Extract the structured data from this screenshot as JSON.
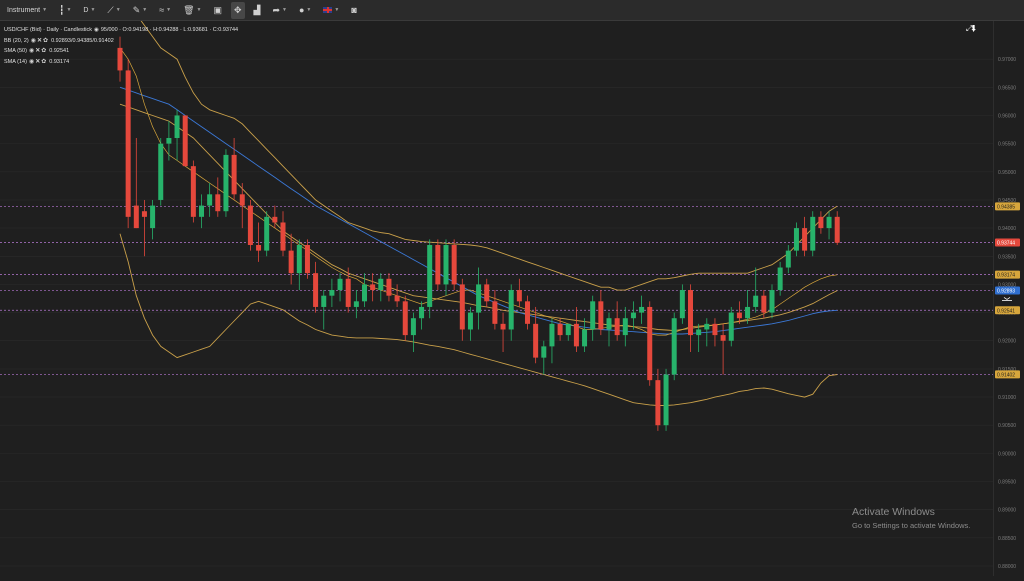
{
  "toolbar": {
    "instrument_label": "Instrument",
    "timeframe_label": "D",
    "flag_label": "UK"
  },
  "legend": {
    "title": "USD/CHF (Bid) · Daily · Candlestick",
    "ohlc": "95/000 · O:0.94198 · H:0.94288 · L:0.93681 · C:0.93744",
    "indicators": [
      {
        "name": "BB (20, 2)",
        "value": "0.92893/0.94385/0.91402"
      },
      {
        "name": "SMA (50)",
        "value": "0.92541"
      },
      {
        "name": "SMA (14)",
        "value": "0.93174"
      }
    ]
  },
  "watermark": {
    "title": "Activate Windows",
    "subtitle": "Go to Settings to activate Windows."
  },
  "colors": {
    "bg": "#1f1f1f",
    "up": "#27b36b",
    "down": "#e5483c",
    "bb": "#c9a04a",
    "sma50": "#3b78d6",
    "sma14": "#d7a63c",
    "level_line": "#b779d4"
  },
  "chart_data": {
    "type": "candlestick",
    "instrument": "USD/CHF (Bid)",
    "timeframe": "Daily",
    "price_axis": {
      "ylim": [
        0.88,
        0.975
      ],
      "ticks": [
        "0.97000",
        "0.96500",
        "0.96000",
        "0.95500",
        "0.95000",
        "0.94500",
        "0.94000",
        "0.93500",
        "0.93000",
        "0.92500",
        "0.92000",
        "0.91500",
        "0.91000",
        "0.90500",
        "0.90000",
        "0.89500",
        "0.89000",
        "0.88500",
        "0.88000"
      ]
    },
    "price_tags": [
      {
        "value": "0.94385",
        "series": "BB upper",
        "color": "#d7a63c",
        "text_color": "#1f1f1f"
      },
      {
        "value": "0.93744",
        "series": "Last close",
        "color": "#e5483c",
        "text_color": "#ffffff"
      },
      {
        "value": "0.93174",
        "series": "SMA (14)",
        "color": "#d7a63c",
        "text_color": "#1f1f1f"
      },
      {
        "value": "0.92893",
        "series": "BB middle",
        "color": "#2f6fd0",
        "text_color": "#ffffff"
      },
      {
        "value": "0.92541",
        "series": "SMA (50)",
        "color": "#d7a63c",
        "text_color": "#1f1f1f"
      },
      {
        "value": "0.91402",
        "series": "BB lower",
        "color": "#d7a63c",
        "text_color": "#1f1f1f"
      }
    ],
    "candles": [
      [
        0.972,
        0.974,
        0.966,
        0.968
      ],
      [
        0.968,
        0.97,
        0.94,
        0.942
      ],
      [
        0.944,
        0.956,
        0.94,
        0.94
      ],
      [
        0.943,
        0.945,
        0.935,
        0.942
      ],
      [
        0.94,
        0.945,
        0.938,
        0.944
      ],
      [
        0.945,
        0.956,
        0.944,
        0.955
      ],
      [
        0.955,
        0.959,
        0.952,
        0.956
      ],
      [
        0.956,
        0.961,
        0.952,
        0.96
      ],
      [
        0.96,
        0.96,
        0.951,
        0.951
      ],
      [
        0.951,
        0.952,
        0.941,
        0.942
      ],
      [
        0.942,
        0.946,
        0.94,
        0.944
      ],
      [
        0.944,
        0.948,
        0.942,
        0.946
      ],
      [
        0.946,
        0.949,
        0.942,
        0.943
      ],
      [
        0.943,
        0.954,
        0.942,
        0.953
      ],
      [
        0.953,
        0.956,
        0.945,
        0.946
      ],
      [
        0.946,
        0.948,
        0.94,
        0.944
      ],
      [
        0.944,
        0.945,
        0.936,
        0.937
      ],
      [
        0.937,
        0.941,
        0.934,
        0.936
      ],
      [
        0.936,
        0.943,
        0.935,
        0.942
      ],
      [
        0.942,
        0.944,
        0.94,
        0.941
      ],
      [
        0.941,
        0.943,
        0.935,
        0.936
      ],
      [
        0.936,
        0.939,
        0.93,
        0.932
      ],
      [
        0.932,
        0.938,
        0.929,
        0.937
      ],
      [
        0.937,
        0.938,
        0.931,
        0.932
      ],
      [
        0.932,
        0.934,
        0.925,
        0.926
      ],
      [
        0.926,
        0.929,
        0.922,
        0.928
      ],
      [
        0.928,
        0.931,
        0.926,
        0.929
      ],
      [
        0.929,
        0.932,
        0.927,
        0.931
      ],
      [
        0.931,
        0.933,
        0.925,
        0.926
      ],
      [
        0.926,
        0.929,
        0.924,
        0.927
      ],
      [
        0.927,
        0.932,
        0.926,
        0.93
      ],
      [
        0.93,
        0.932,
        0.927,
        0.929
      ],
      [
        0.929,
        0.932,
        0.927,
        0.931
      ],
      [
        0.931,
        0.932,
        0.927,
        0.928
      ],
      [
        0.928,
        0.93,
        0.926,
        0.927
      ],
      [
        0.927,
        0.928,
        0.92,
        0.921
      ],
      [
        0.921,
        0.925,
        0.918,
        0.924
      ],
      [
        0.924,
        0.927,
        0.922,
        0.926
      ],
      [
        0.926,
        0.938,
        0.924,
        0.937
      ],
      [
        0.937,
        0.938,
        0.929,
        0.93
      ],
      [
        0.93,
        0.938,
        0.928,
        0.937
      ],
      [
        0.937,
        0.938,
        0.929,
        0.93
      ],
      [
        0.93,
        0.931,
        0.92,
        0.922
      ],
      [
        0.922,
        0.926,
        0.92,
        0.925
      ],
      [
        0.925,
        0.933,
        0.922,
        0.93
      ],
      [
        0.93,
        0.931,
        0.926,
        0.927
      ],
      [
        0.927,
        0.929,
        0.922,
        0.923
      ],
      [
        0.923,
        0.925,
        0.918,
        0.922
      ],
      [
        0.922,
        0.93,
        0.92,
        0.929
      ],
      [
        0.929,
        0.931,
        0.926,
        0.927
      ],
      [
        0.927,
        0.928,
        0.922,
        0.923
      ],
      [
        0.923,
        0.926,
        0.916,
        0.917
      ],
      [
        0.917,
        0.92,
        0.914,
        0.919
      ],
      [
        0.919,
        0.924,
        0.916,
        0.923
      ],
      [
        0.923,
        0.924,
        0.92,
        0.921
      ],
      [
        0.921,
        0.923,
        0.92,
        0.923
      ],
      [
        0.923,
        0.926,
        0.918,
        0.919
      ],
      [
        0.919,
        0.924,
        0.918,
        0.922
      ],
      [
        0.922,
        0.928,
        0.92,
        0.927
      ],
      [
        0.927,
        0.929,
        0.921,
        0.922
      ],
      [
        0.922,
        0.925,
        0.919,
        0.924
      ],
      [
        0.924,
        0.927,
        0.92,
        0.921
      ],
      [
        0.921,
        0.926,
        0.919,
        0.924
      ],
      [
        0.924,
        0.927,
        0.922,
        0.925
      ],
      [
        0.925,
        0.928,
        0.923,
        0.926
      ],
      [
        0.926,
        0.927,
        0.912,
        0.913
      ],
      [
        0.913,
        0.915,
        0.904,
        0.905
      ],
      [
        0.905,
        0.915,
        0.904,
        0.914
      ],
      [
        0.914,
        0.925,
        0.913,
        0.924
      ],
      [
        0.924,
        0.93,
        0.923,
        0.929
      ],
      [
        0.929,
        0.93,
        0.918,
        0.921
      ],
      [
        0.921,
        0.923,
        0.918,
        0.922
      ],
      [
        0.922,
        0.924,
        0.919,
        0.923
      ],
      [
        0.923,
        0.924,
        0.919,
        0.921
      ],
      [
        0.921,
        0.923,
        0.914,
        0.92
      ],
      [
        0.92,
        0.926,
        0.919,
        0.925
      ],
      [
        0.925,
        0.927,
        0.923,
        0.924
      ],
      [
        0.924,
        0.929,
        0.923,
        0.926
      ],
      [
        0.926,
        0.933,
        0.925,
        0.928
      ],
      [
        0.928,
        0.929,
        0.924,
        0.925
      ],
      [
        0.925,
        0.93,
        0.924,
        0.929
      ],
      [
        0.929,
        0.934,
        0.928,
        0.933
      ],
      [
        0.933,
        0.937,
        0.932,
        0.936
      ],
      [
        0.936,
        0.941,
        0.935,
        0.94
      ],
      [
        0.94,
        0.942,
        0.935,
        0.936
      ],
      [
        0.936,
        0.943,
        0.935,
        0.942
      ],
      [
        0.942,
        0.943,
        0.939,
        0.94
      ],
      [
        0.94,
        0.943,
        0.938,
        0.942
      ],
      [
        0.942,
        0.943,
        0.937,
        0.9374
      ]
    ],
    "bb_upper": [
      0.985,
      0.982,
      0.978,
      0.976,
      0.974,
      0.972,
      0.971,
      0.97,
      0.9668,
      0.964,
      0.962,
      0.961,
      0.9605,
      0.96,
      0.9595,
      0.9585,
      0.957,
      0.9555,
      0.954,
      0.9525,
      0.951,
      0.9495,
      0.948,
      0.9465,
      0.945,
      0.944,
      0.943,
      0.942,
      0.941,
      0.9405,
      0.94,
      0.9395,
      0.9392,
      0.939,
      0.9385,
      0.938,
      0.9378,
      0.9376,
      0.9375,
      0.9374,
      0.9373,
      0.9372,
      0.9371,
      0.937,
      0.9368,
      0.9365,
      0.936,
      0.9355,
      0.935,
      0.9345,
      0.934,
      0.9335,
      0.933,
      0.9325,
      0.932,
      0.9315,
      0.931,
      0.9305,
      0.93,
      0.9295,
      0.9295,
      0.929,
      0.929,
      0.9295,
      0.93,
      0.9305,
      0.931,
      0.931,
      0.9312,
      0.9315,
      0.9318,
      0.932,
      0.932,
      0.932,
      0.932,
      0.932,
      0.932,
      0.932,
      0.9325,
      0.933,
      0.9335,
      0.9345,
      0.9355,
      0.937,
      0.9385,
      0.94,
      0.9415,
      0.943,
      0.9439
    ],
    "bb_middle": [
      0.962,
      0.9615,
      0.961,
      0.9605,
      0.96,
      0.9595,
      0.959,
      0.958,
      0.957,
      0.956,
      0.9545,
      0.953,
      0.9515,
      0.95,
      0.9485,
      0.947,
      0.9455,
      0.944,
      0.9425,
      0.941,
      0.9395,
      0.9385,
      0.9375,
      0.9365,
      0.9355,
      0.9345,
      0.9335,
      0.9328,
      0.932,
      0.9315,
      0.931,
      0.9305,
      0.93,
      0.9295,
      0.929,
      0.9285,
      0.928,
      0.9278,
      0.9276,
      0.9274,
      0.9272,
      0.927,
      0.9268,
      0.9265,
      0.9262,
      0.926,
      0.9257,
      0.9254,
      0.9252,
      0.925,
      0.9248,
      0.9246,
      0.9244,
      0.9242,
      0.924,
      0.9238,
      0.9236,
      0.9234,
      0.9232,
      0.923,
      0.9228,
      0.9227,
      0.9226,
      0.9225,
      0.9224,
      0.9222,
      0.922,
      0.9219,
      0.9218,
      0.922,
      0.9222,
      0.9224,
      0.9226,
      0.9228,
      0.923,
      0.9232,
      0.9234,
      0.9236,
      0.9238,
      0.924,
      0.9243,
      0.9246,
      0.925,
      0.9255,
      0.926,
      0.9266,
      0.9274,
      0.9282,
      0.9289
    ],
    "bb_lower": [
      0.939,
      0.934,
      0.928,
      0.924,
      0.921,
      0.919,
      0.918,
      0.917,
      0.9175,
      0.918,
      0.9185,
      0.919,
      0.9205,
      0.922,
      0.9235,
      0.925,
      0.9265,
      0.927,
      0.9265,
      0.926,
      0.9255,
      0.9245,
      0.9235,
      0.9228,
      0.922,
      0.9215,
      0.921,
      0.9208,
      0.9206,
      0.9205,
      0.9205,
      0.9205,
      0.9204,
      0.9203,
      0.9202,
      0.92,
      0.9198,
      0.9195,
      0.9192,
      0.919,
      0.9187,
      0.9184,
      0.918,
      0.9176,
      0.9172,
      0.9168,
      0.9164,
      0.916,
      0.9156,
      0.9152,
      0.9148,
      0.9144,
      0.914,
      0.9136,
      0.9132,
      0.9128,
      0.9124,
      0.912,
      0.9115,
      0.911,
      0.9105,
      0.91,
      0.9095,
      0.909,
      0.9088,
      0.9086,
      0.9085,
      0.9085,
      0.9086,
      0.9088,
      0.909,
      0.9093,
      0.9096,
      0.91,
      0.9103,
      0.9106,
      0.911,
      0.9112,
      0.9115,
      0.9116,
      0.9114,
      0.911,
      0.9106,
      0.9103,
      0.91,
      0.9105,
      0.9125,
      0.9138,
      0.914
    ],
    "sma50": [
      0.965,
      0.9645,
      0.964,
      0.9635,
      0.963,
      0.9625,
      0.962,
      0.961,
      0.96,
      0.959,
      0.958,
      0.957,
      0.956,
      0.955,
      0.954,
      0.953,
      0.952,
      0.951,
      0.95,
      0.949,
      0.948,
      0.947,
      0.946,
      0.945,
      0.944,
      0.9432,
      0.9424,
      0.9416,
      0.9408,
      0.94,
      0.9392,
      0.9384,
      0.9376,
      0.9368,
      0.936,
      0.9352,
      0.9344,
      0.9336,
      0.9328,
      0.932,
      0.9312,
      0.9304,
      0.9296,
      0.9288,
      0.928,
      0.9274,
      0.9268,
      0.9262,
      0.9256,
      0.925,
      0.9246,
      0.9242,
      0.9238,
      0.9234,
      0.923,
      0.9228,
      0.9226,
      0.9224,
      0.9222,
      0.922,
      0.9219,
      0.9218,
      0.9217,
      0.9216,
      0.9215,
      0.9214,
      0.9213,
      0.9212,
      0.9212,
      0.9212,
      0.9213,
      0.9214,
      0.9215,
      0.9216,
      0.9218,
      0.922,
      0.9222,
      0.9224,
      0.9226,
      0.9228,
      0.923,
      0.9233,
      0.9236,
      0.924,
      0.9244,
      0.9248,
      0.9251,
      0.9253,
      0.9254
    ],
    "sma14": [
      0.972,
      0.97,
      0.967,
      0.962,
      0.958,
      0.955,
      0.953,
      0.952,
      0.951,
      0.95,
      0.949,
      0.948,
      0.947,
      0.946,
      0.945,
      0.944,
      0.943,
      0.942,
      0.941,
      0.94,
      0.939,
      0.938,
      0.937,
      0.936,
      0.935,
      0.934,
      0.933,
      0.9322,
      0.9315,
      0.931,
      0.93,
      0.9295,
      0.929,
      0.9285,
      0.928,
      0.9275,
      0.927,
      0.9265,
      0.927,
      0.9275,
      0.928,
      0.9285,
      0.929,
      0.929,
      0.9285,
      0.928,
      0.9275,
      0.927,
      0.9265,
      0.926,
      0.9255,
      0.925,
      0.9245,
      0.924,
      0.9235,
      0.923,
      0.9225,
      0.922,
      0.922,
      0.9222,
      0.9224,
      0.9226,
      0.9228,
      0.9225,
      0.922,
      0.9212,
      0.921,
      0.921,
      0.9215,
      0.922,
      0.9225,
      0.9226,
      0.9227,
      0.9228,
      0.923,
      0.9232,
      0.9235,
      0.9238,
      0.9242,
      0.9248,
      0.9255,
      0.9265,
      0.9275,
      0.9285,
      0.9295,
      0.9303,
      0.931,
      0.9315,
      0.9317
    ]
  }
}
